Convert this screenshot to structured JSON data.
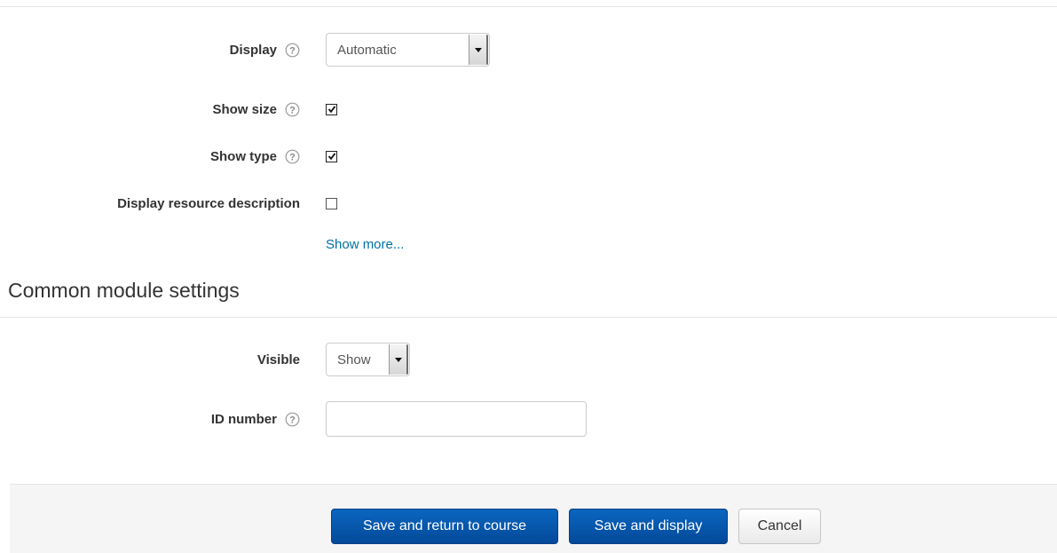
{
  "appearance": {
    "display": {
      "label": "Display",
      "value": "Automatic"
    },
    "show_size": {
      "label": "Show size",
      "checked": true
    },
    "show_type": {
      "label": "Show type",
      "checked": true
    },
    "display_description": {
      "label": "Display resource description",
      "checked": false
    },
    "show_more_link": "Show more..."
  },
  "common_module": {
    "title": "Common module settings",
    "visible": {
      "label": "Visible",
      "value": "Show"
    },
    "id_number": {
      "label": "ID number",
      "value": "",
      "placeholder": ""
    }
  },
  "footer": {
    "save_return_label": "Save and return to course",
    "save_display_label": "Save and display",
    "cancel_label": "Cancel"
  },
  "colors": {
    "primary_button": "#04499a",
    "link": "#0070a8"
  },
  "icons": {
    "help": "question-circle-icon",
    "dropdown": "chevron-down-icon",
    "check": "checkmark-icon"
  }
}
